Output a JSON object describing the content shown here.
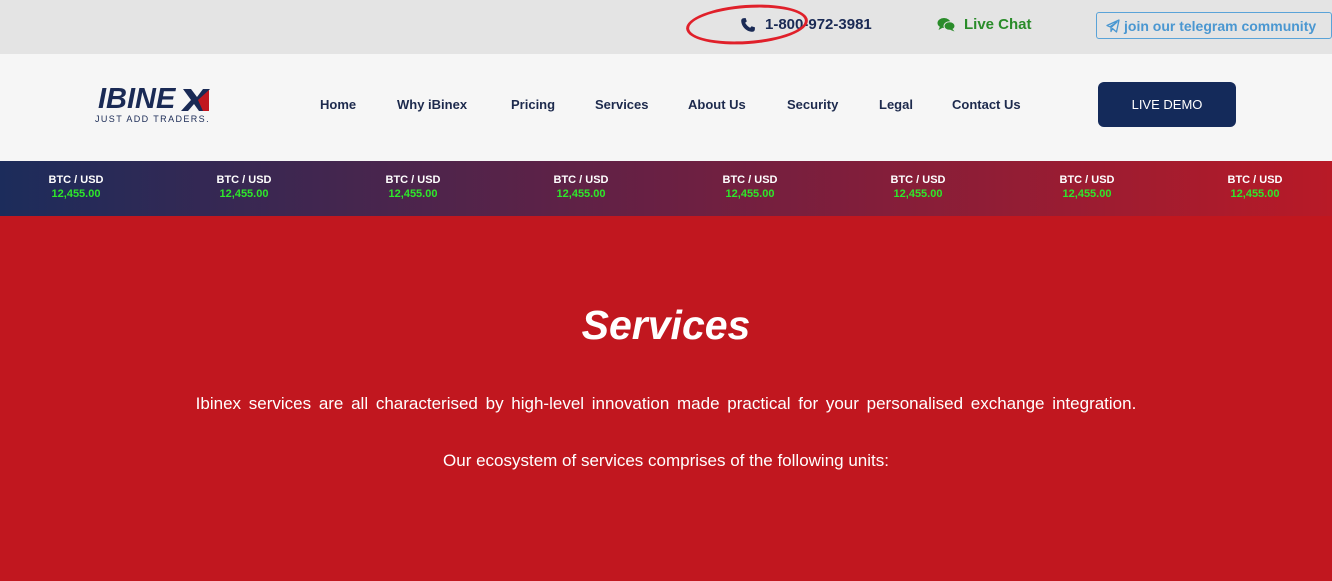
{
  "topbar": {
    "phone": "1-800-972-3981",
    "live_chat": "Live Chat",
    "telegram": "join our telegram community",
    "phone_icon": "phone-icon",
    "chat_icon": "chat-icon",
    "telegram_icon": "telegram-icon"
  },
  "logo": {
    "word": "IBINE",
    "tagline": "JUST ADD TRADERS."
  },
  "nav": [
    "Home",
    "Why iBinex",
    "Pricing",
    "Services",
    "About Us",
    "Security",
    "Legal",
    "Contact Us"
  ],
  "demo_button": "LIVE DEMO",
  "ticker": [
    {
      "pair": "BTC / USD",
      "price": "12,455.00"
    },
    {
      "pair": "BTC / USD",
      "price": "12,455.00"
    },
    {
      "pair": "BTC / USD",
      "price": "12,455.00"
    },
    {
      "pair": "BTC / USD",
      "price": "12,455.00"
    },
    {
      "pair": "BTC / USD",
      "price": "12,455.00"
    },
    {
      "pair": "BTC / USD",
      "price": "12,455.00"
    },
    {
      "pair": "BTC / USD",
      "price": "12,455.00"
    },
    {
      "pair": "BTC / USD",
      "price": "12,455.00"
    }
  ],
  "main": {
    "title": "Services",
    "intro": "Ibinex services are all characterised by high-level innovation made practical for your personalised exchange integration.",
    "sub": "Our ecosystem of services comprises of the following units:"
  },
  "colors": {
    "brand_navy": "#1a2a55",
    "brand_red": "#c1171f",
    "price_green": "#2ee82a",
    "chat_green": "#2a8c2a",
    "telegram_blue": "#4a97d1"
  }
}
